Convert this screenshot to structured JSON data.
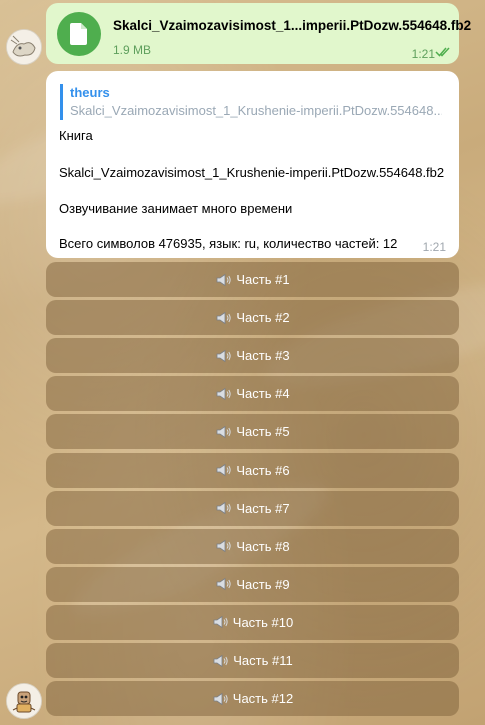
{
  "file_message": {
    "filename": "Skalci_Vzaimozavisimost_1...imperii.PtDozw.554648.fb2",
    "size": "1.9 MB",
    "time": "1:21"
  },
  "bot_message": {
    "reply_author": "theurs",
    "reply_text": "Skalci_Vzaimozavisimost_1_Krushenie-imperii.PtDozw.554648...",
    "lines": [
      "Книга",
      "Skalci_Vzaimozavisimost_1_Krushenie-imperii.PtDozw.554648.fb2",
      "Озвучивание занимает много времени",
      "Всего символов 476935, язык: ru, количество частей: 12"
    ],
    "time": "1:21"
  },
  "buttons": [
    "Часть #1",
    "Часть #2",
    "Часть #3",
    "Часть #4",
    "Часть #5",
    "Часть #6",
    "Часть #7",
    "Часть #8",
    "Часть #9",
    "Часть #10",
    "Часть #11",
    "Часть #12"
  ]
}
